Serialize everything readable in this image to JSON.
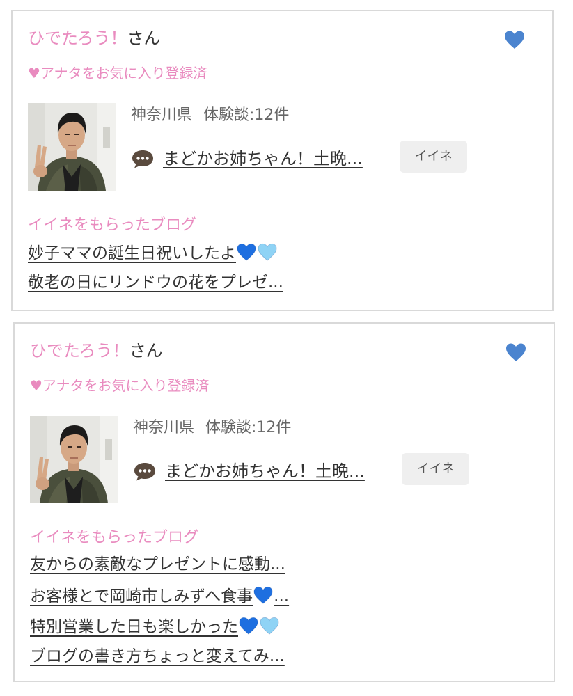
{
  "colors": {
    "pink": "#e98bbf",
    "heart_blue": "#4b84cf",
    "heart_light_blue": "#8fd3f5",
    "border": "#d9d9d9",
    "button_bg": "#efefef"
  },
  "cards": [
    {
      "user_name": "ひでたろう！",
      "user_suffix": "さん",
      "heart_icon": "heart-icon",
      "favorite_status": "♥アナタをお気に入り登録済",
      "prefecture": "神奈川県",
      "reviews_label": "体験談:12件",
      "post_icon": "chat-bubble-icon",
      "post_title": "まどかお姉ちゃん！土晩...",
      "like_button": "イイネ",
      "blogs_heading": "イイネをもらったブログ",
      "blogs": [
        {
          "text": "妙子ママの誕生日祝いしたよ",
          "hearts": [
            "#1e6fe0",
            "#8fd3f5"
          ]
        },
        {
          "text": "敬老の日にリンドウの花をプレゼ...",
          "hearts": []
        }
      ]
    },
    {
      "user_name": "ひでたろう！",
      "user_suffix": "さん",
      "heart_icon": "heart-icon",
      "favorite_status": "♥アナタをお気に入り登録済",
      "prefecture": "神奈川県",
      "reviews_label": "体験談:12件",
      "post_icon": "chat-bubble-icon",
      "post_title": "まどかお姉ちゃん！土晩...",
      "like_button": "イイネ",
      "blogs_heading": "イイネをもらったブログ",
      "blogs": [
        {
          "text": "友からの素敵なプレゼントに感動...",
          "hearts": []
        },
        {
          "text": "お客様とで岡崎市しみずへ食事",
          "hearts": [
            "#1e6fe0"
          ],
          "suffix": "..."
        },
        {
          "text": "特別営業した日も楽しかった",
          "hearts": [
            "#1e6fe0",
            "#8fd3f5"
          ]
        },
        {
          "text": "ブログの書き方ちょっと変えてみ...",
          "hearts": []
        }
      ]
    }
  ]
}
